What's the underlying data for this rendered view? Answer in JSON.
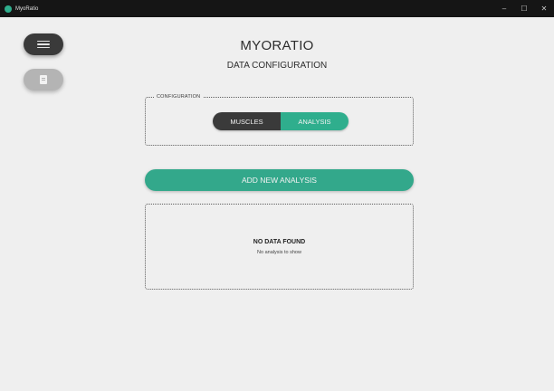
{
  "window": {
    "title": "MyoRatio",
    "controls": {
      "minimize": "–",
      "maximize": "☐",
      "close": "✕"
    }
  },
  "sidebar": {
    "menu_icon": "hamburger-menu-icon",
    "doc_icon": "document-icon"
  },
  "header": {
    "title": "MYORATIO",
    "subtitle": "DATA CONFIGURATION"
  },
  "configuration": {
    "legend": "CONFIGURATION",
    "options": [
      "MUSCLES",
      "ANALYSIS"
    ],
    "selected": "ANALYSIS"
  },
  "actions": {
    "add_label": "ADD NEW ANALYSIS"
  },
  "data_panel": {
    "empty_title": "NO DATA FOUND",
    "empty_subtitle": "No analysis to show"
  },
  "colors": {
    "accent": "#2fae8d",
    "dark": "#3a3a3a",
    "background": "#efefef",
    "titlebar": "#151515"
  }
}
